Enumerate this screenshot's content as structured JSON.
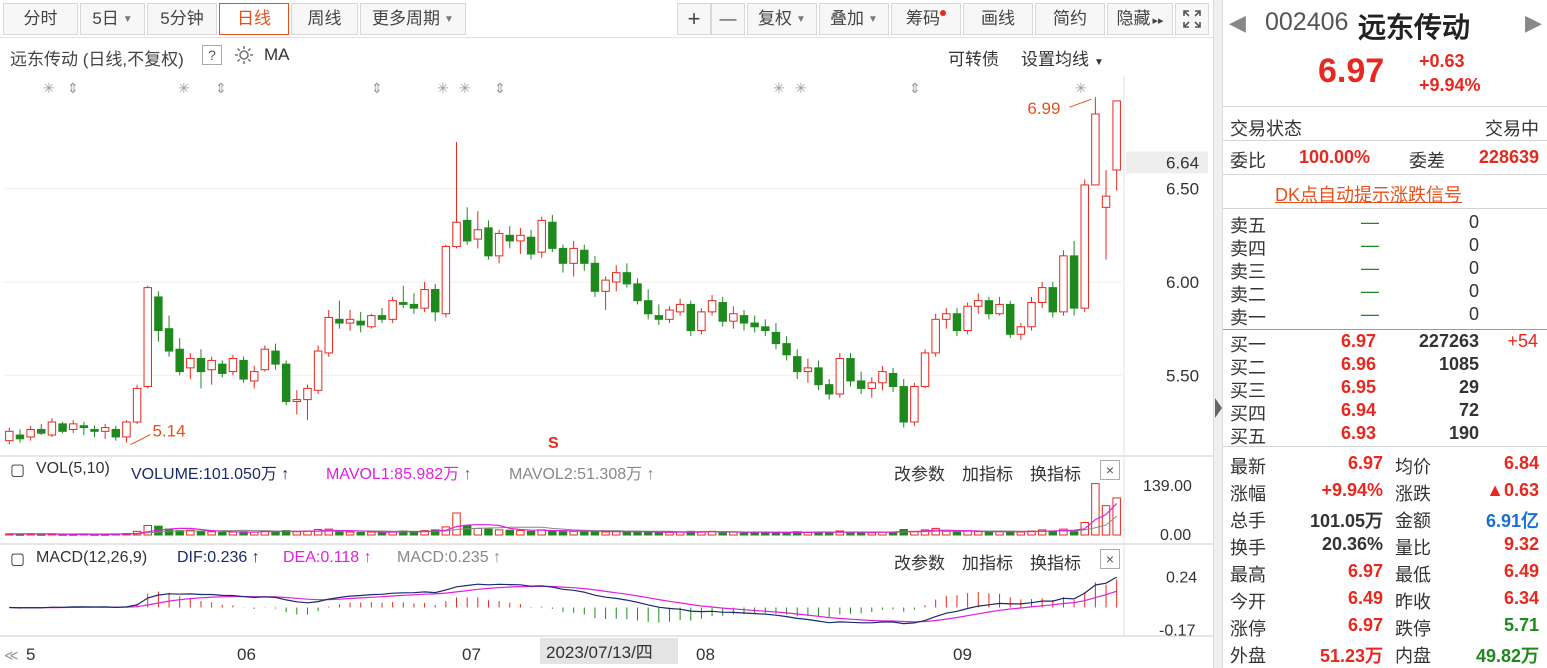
{
  "toolbar": {
    "left_tabs": [
      "分时",
      "5日",
      "5分钟",
      "日线",
      "周线",
      "更多周期"
    ],
    "active_tab": "日线",
    "plus": "+",
    "minus": "—",
    "right_buttons": [
      "复权",
      "叠加",
      "筹码",
      "画线",
      "简约",
      "隐藏"
    ],
    "hide_arrows": "▸▸"
  },
  "main_chart": {
    "title": "远东传动 (日线,不复权)",
    "help": "?",
    "ma_label": "MA",
    "convertible_bond": "可转债",
    "set_ma": "设置均线",
    "high_label": "6.99",
    "low_label": "5.14",
    "marker_s": "S",
    "current_price_tag": "6.64",
    "y_ticks": [
      "6.50",
      "6.00",
      "5.50"
    ]
  },
  "vol_panel": {
    "title": "VOL(5,10)",
    "volume": "VOLUME:101.050万",
    "mavol1": "MAVOL1:85.982万",
    "mavol2": "MAVOL2:51.308万",
    "y_ticks": [
      "139.00",
      "0.00"
    ],
    "btn_params": "改参数",
    "btn_add": "加指标",
    "btn_switch": "换指标",
    "close": "×"
  },
  "macd_panel": {
    "title": "MACD(12,26,9)",
    "dif": "DIF:0.236",
    "dea": "DEA:0.118",
    "macd": "MACD:0.235",
    "y_ticks": [
      "0.24",
      "-0.17"
    ],
    "btn_params": "改参数",
    "btn_add": "加指标",
    "btn_switch": "换指标",
    "close": "×"
  },
  "x_axis": {
    "scroll_left": "≪",
    "labels": [
      "5",
      "06",
      "07",
      "08",
      "09"
    ],
    "cursor_date": "2023/07/13/四"
  },
  "quote": {
    "code": "002406",
    "name": "远东传动",
    "price": "6.97",
    "change": "+0.63",
    "change_pct": "+9.94%",
    "status_label": "交易状态",
    "status_value": "交易中",
    "weibi_label": "委比",
    "weibi_value": "100.00%",
    "weicha_label": "委差",
    "weicha_value": "228639",
    "dk_signal": "DK点自动提示涨跌信号",
    "asks": [
      {
        "label": "卖五",
        "price": "—",
        "vol": "0"
      },
      {
        "label": "卖四",
        "price": "—",
        "vol": "0"
      },
      {
        "label": "卖三",
        "price": "—",
        "vol": "0"
      },
      {
        "label": "卖二",
        "price": "—",
        "vol": "0"
      },
      {
        "label": "卖一",
        "price": "—",
        "vol": "0"
      }
    ],
    "bids": [
      {
        "label": "买一",
        "price": "6.97",
        "vol": "227263",
        "delta": "+54"
      },
      {
        "label": "买二",
        "price": "6.96",
        "vol": "1085",
        "delta": ""
      },
      {
        "label": "买三",
        "price": "6.95",
        "vol": "29",
        "delta": ""
      },
      {
        "label": "买四",
        "price": "6.94",
        "vol": "72",
        "delta": ""
      },
      {
        "label": "买五",
        "price": "6.93",
        "vol": "190",
        "delta": ""
      }
    ],
    "stats": [
      {
        "l1": "最新",
        "v1": "6.97",
        "l2": "均价",
        "v2": "6.84"
      },
      {
        "l1": "涨幅",
        "v1": "+9.94%",
        "l2": "涨跌",
        "v2": "▲0.63"
      },
      {
        "l1": "总手",
        "v1": "101.05万",
        "l2": "金额",
        "v2": "6.91亿"
      },
      {
        "l1": "换手",
        "v1": "20.36%",
        "l2": "量比",
        "v2": "9.32"
      },
      {
        "l1": "最高",
        "v1": "6.97",
        "l2": "最低",
        "v2": "6.49"
      },
      {
        "l1": "今开",
        "v1": "6.49",
        "l2": "昨收",
        "v2": "6.34"
      },
      {
        "l1": "涨停",
        "v1": "6.97",
        "l2": "跌停",
        "v2": "5.71"
      },
      {
        "l1": "外盘",
        "v1": "51.23万",
        "l2": "内盘",
        "v2": "49.82万"
      }
    ]
  },
  "colors": {
    "up": "#e8281e",
    "down": "#1e8a1e",
    "accent": "#e8501a",
    "mavol1": "#e020e0",
    "dark_navy": "#1a2a6a"
  },
  "chart_data": {
    "type": "candlestick",
    "start_date": "2023-05-01",
    "ohlc": [
      [
        5.15,
        5.22,
        5.13,
        5.2
      ],
      [
        5.18,
        5.21,
        5.14,
        5.16
      ],
      [
        5.17,
        5.23,
        5.15,
        5.21
      ],
      [
        5.21,
        5.24,
        5.18,
        5.19
      ],
      [
        5.18,
        5.27,
        5.17,
        5.25
      ],
      [
        5.24,
        5.25,
        5.19,
        5.2
      ],
      [
        5.21,
        5.26,
        5.19,
        5.24
      ],
      [
        5.23,
        5.25,
        5.18,
        5.22
      ],
      [
        5.21,
        5.23,
        5.17,
        5.2
      ],
      [
        5.2,
        5.24,
        5.16,
        5.22
      ],
      [
        5.21,
        5.23,
        5.15,
        5.17
      ],
      [
        5.17,
        5.26,
        5.14,
        5.25
      ],
      [
        5.25,
        5.45,
        5.24,
        5.43
      ],
      [
        5.44,
        5.98,
        5.43,
        5.97
      ],
      [
        5.92,
        5.95,
        5.68,
        5.74
      ],
      [
        5.75,
        5.82,
        5.6,
        5.63
      ],
      [
        5.64,
        5.7,
        5.5,
        5.52
      ],
      [
        5.54,
        5.62,
        5.48,
        5.59
      ],
      [
        5.59,
        5.64,
        5.43,
        5.52
      ],
      [
        5.53,
        5.6,
        5.45,
        5.58
      ],
      [
        5.56,
        5.58,
        5.49,
        5.51
      ],
      [
        5.52,
        5.61,
        5.5,
        5.59
      ],
      [
        5.58,
        5.6,
        5.46,
        5.48
      ],
      [
        5.47,
        5.55,
        5.43,
        5.52
      ],
      [
        5.53,
        5.66,
        5.52,
        5.64
      ],
      [
        5.63,
        5.67,
        5.53,
        5.56
      ],
      [
        5.56,
        5.58,
        5.34,
        5.36
      ],
      [
        5.36,
        5.42,
        5.29,
        5.37
      ],
      [
        5.37,
        5.45,
        5.26,
        5.43
      ],
      [
        5.42,
        5.66,
        5.4,
        5.63
      ],
      [
        5.62,
        5.85,
        5.6,
        5.81
      ],
      [
        5.8,
        5.9,
        5.75,
        5.78
      ],
      [
        5.78,
        5.85,
        5.74,
        5.8
      ],
      [
        5.79,
        5.84,
        5.73,
        5.77
      ],
      [
        5.76,
        5.83,
        5.75,
        5.82
      ],
      [
        5.82,
        5.86,
        5.78,
        5.8
      ],
      [
        5.8,
        5.92,
        5.78,
        5.9
      ],
      [
        5.89,
        5.98,
        5.86,
        5.88
      ],
      [
        5.88,
        5.94,
        5.83,
        5.86
      ],
      [
        5.86,
        6.0,
        5.84,
        5.96
      ],
      [
        5.96,
        5.99,
        5.79,
        5.84
      ],
      [
        5.83,
        6.2,
        5.81,
        6.19
      ],
      [
        6.19,
        6.75,
        6.18,
        6.32
      ],
      [
        6.33,
        6.4,
        6.2,
        6.22
      ],
      [
        6.23,
        6.38,
        6.18,
        6.28
      ],
      [
        6.29,
        6.33,
        6.12,
        6.14
      ],
      [
        6.14,
        6.28,
        6.1,
        6.26
      ],
      [
        6.25,
        6.3,
        6.18,
        6.22
      ],
      [
        6.22,
        6.29,
        6.15,
        6.25
      ],
      [
        6.24,
        6.28,
        6.12,
        6.15
      ],
      [
        6.16,
        6.35,
        6.13,
        6.33
      ],
      [
        6.32,
        6.36,
        6.16,
        6.18
      ],
      [
        6.18,
        6.2,
        6.05,
        6.1
      ],
      [
        6.1,
        6.22,
        6.03,
        6.18
      ],
      [
        6.17,
        6.2,
        6.06,
        6.1
      ],
      [
        6.1,
        6.14,
        5.92,
        5.95
      ],
      [
        5.95,
        6.03,
        5.85,
        6.01
      ],
      [
        6.0,
        6.09,
        5.95,
        6.05
      ],
      [
        6.05,
        6.1,
        5.97,
        5.99
      ],
      [
        5.99,
        6.02,
        5.88,
        5.9
      ],
      [
        5.9,
        5.96,
        5.8,
        5.83
      ],
      [
        5.82,
        5.88,
        5.77,
        5.8
      ],
      [
        5.8,
        5.87,
        5.78,
        5.85
      ],
      [
        5.84,
        5.91,
        5.82,
        5.88
      ],
      [
        5.88,
        5.9,
        5.71,
        5.74
      ],
      [
        5.74,
        5.86,
        5.72,
        5.84
      ],
      [
        5.84,
        5.93,
        5.82,
        5.9
      ],
      [
        5.89,
        5.92,
        5.76,
        5.79
      ],
      [
        5.79,
        5.87,
        5.75,
        5.83
      ],
      [
        5.82,
        5.85,
        5.74,
        5.78
      ],
      [
        5.78,
        5.82,
        5.73,
        5.76
      ],
      [
        5.76,
        5.8,
        5.71,
        5.74
      ],
      [
        5.73,
        5.78,
        5.64,
        5.67
      ],
      [
        5.67,
        5.71,
        5.58,
        5.61
      ],
      [
        5.6,
        5.64,
        5.48,
        5.52
      ],
      [
        5.52,
        5.59,
        5.46,
        5.54
      ],
      [
        5.54,
        5.58,
        5.42,
        5.45
      ],
      [
        5.45,
        5.48,
        5.37,
        5.4
      ],
      [
        5.4,
        5.62,
        5.38,
        5.59
      ],
      [
        5.59,
        5.62,
        5.44,
        5.47
      ],
      [
        5.47,
        5.52,
        5.4,
        5.43
      ],
      [
        5.43,
        5.49,
        5.38,
        5.46
      ],
      [
        5.46,
        5.55,
        5.42,
        5.52
      ],
      [
        5.51,
        5.54,
        5.41,
        5.44
      ],
      [
        5.44,
        5.48,
        5.22,
        5.25
      ],
      [
        5.25,
        5.46,
        5.23,
        5.44
      ],
      [
        5.44,
        5.64,
        5.43,
        5.62
      ],
      [
        5.62,
        5.83,
        5.6,
        5.8
      ],
      [
        5.8,
        5.86,
        5.75,
        5.83
      ],
      [
        5.83,
        5.86,
        5.71,
        5.74
      ],
      [
        5.74,
        5.89,
        5.72,
        5.87
      ],
      [
        5.87,
        5.94,
        5.83,
        5.9
      ],
      [
        5.9,
        5.92,
        5.8,
        5.83
      ],
      [
        5.83,
        5.92,
        5.82,
        5.88
      ],
      [
        5.88,
        5.9,
        5.7,
        5.72
      ],
      [
        5.72,
        5.78,
        5.69,
        5.76
      ],
      [
        5.76,
        5.92,
        5.74,
        5.89
      ],
      [
        5.89,
        6.0,
        5.86,
        5.97
      ],
      [
        5.97,
        6.0,
        5.81,
        5.84
      ],
      [
        5.84,
        6.17,
        5.82,
        6.14
      ],
      [
        6.14,
        6.22,
        5.82,
        5.86
      ],
      [
        5.86,
        6.55,
        5.84,
        6.52
      ],
      [
        6.52,
        6.99,
        6.52,
        6.9
      ],
      [
        6.4,
        6.6,
        6.12,
        6.46
      ],
      [
        6.6,
        6.97,
        6.49,
        6.97
      ]
    ],
    "volume": [
      3,
      2,
      3,
      2,
      3,
      2,
      2,
      3,
      2,
      2,
      3,
      4,
      10,
      26,
      24,
      16,
      12,
      13,
      9,
      9,
      7,
      8,
      9,
      8,
      11,
      10,
      12,
      9,
      11,
      15,
      16,
      10,
      8,
      7,
      8,
      7,
      9,
      11,
      8,
      12,
      14,
      22,
      60,
      26,
      18,
      16,
      14,
      13,
      12,
      10,
      14,
      12,
      9,
      10,
      8,
      11,
      8,
      9,
      8,
      9,
      9,
      7,
      7,
      8,
      10,
      9,
      10,
      8,
      8,
      7,
      7,
      6,
      8,
      7,
      9,
      7,
      8,
      7,
      11,
      8,
      7,
      6,
      8,
      7,
      15,
      10,
      14,
      18,
      10,
      9,
      11,
      9,
      8,
      9,
      10,
      8,
      11,
      14,
      10,
      16,
      12,
      34,
      140,
      80,
      101
    ],
    "mavol1": [
      3,
      3,
      3,
      3,
      3,
      2,
      2,
      2,
      2,
      2,
      2,
      3,
      4,
      9,
      13,
      16,
      18,
      18,
      15,
      12,
      10,
      9,
      8,
      8,
      9,
      9,
      10,
      10,
      10,
      11,
      13,
      12,
      12,
      11,
      10,
      8,
      8,
      9,
      9,
      9,
      11,
      13,
      23,
      27,
      28,
      28,
      26,
      18,
      15,
      13,
      13,
      12,
      12,
      11,
      11,
      10,
      10,
      9,
      9,
      9,
      9,
      8,
      8,
      8,
      8,
      8,
      9,
      9,
      9,
      8,
      8,
      8,
      7,
      7,
      7,
      7,
      8,
      8,
      8,
      8,
      8,
      8,
      8,
      8,
      10,
      9,
      11,
      13,
      13,
      12,
      12,
      11,
      9,
      9,
      9,
      9,
      9,
      10,
      11,
      12,
      13,
      17,
      42,
      56,
      86
    ],
    "mavol2": [
      3,
      3,
      3,
      3,
      3,
      3,
      3,
      3,
      3,
      3,
      3,
      3,
      3,
      6,
      8,
      10,
      11,
      11,
      11,
      11,
      12,
      12,
      13,
      12,
      12,
      11,
      10,
      10,
      10,
      10,
      10,
      10,
      10,
      11,
      11,
      11,
      10,
      10,
      10,
      10,
      10,
      11,
      15,
      17,
      18,
      19,
      20,
      21,
      21,
      21,
      21,
      18,
      16,
      14,
      13,
      12,
      12,
      12,
      11,
      11,
      10,
      10,
      10,
      9,
      9,
      9,
      9,
      8,
      8,
      8,
      8,
      8,
      8,
      8,
      8,
      8,
      8,
      8,
      8,
      8,
      8,
      8,
      8,
      8,
      9,
      9,
      9,
      10,
      10,
      10,
      10,
      10,
      11,
      11,
      11,
      10,
      10,
      10,
      11,
      11,
      11,
      14,
      20,
      27,
      51
    ],
    "y_range": [
      5.1,
      7.05
    ],
    "vol_range": [
      0,
      139
    ],
    "macd_range": [
      -0.19,
      0.26
    ],
    "dif_last": 0.236,
    "dea_last": 0.118,
    "macd_last": 0.235
  }
}
